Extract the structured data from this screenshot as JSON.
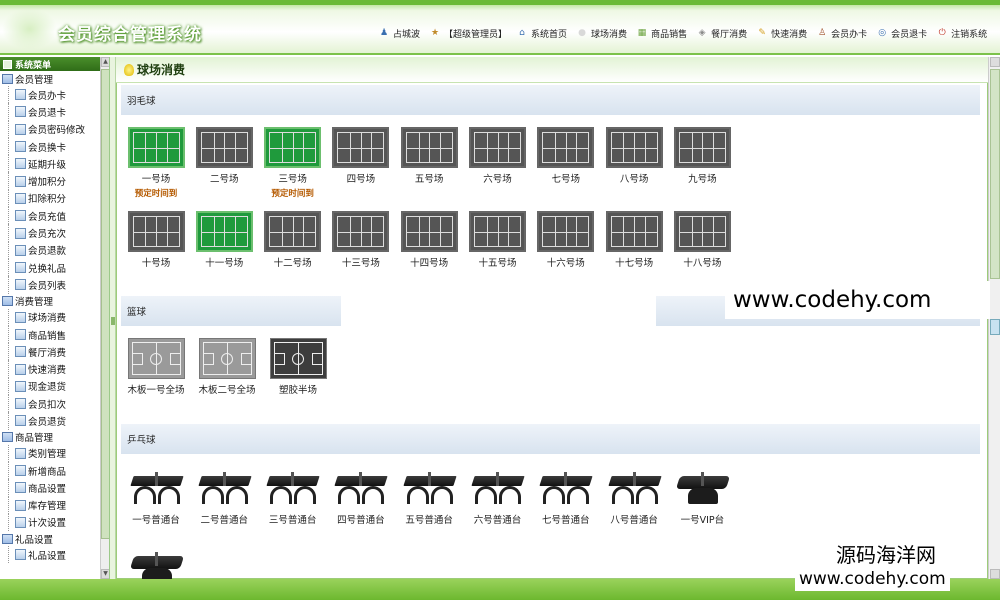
{
  "app": {
    "title": "会员综合管理系统"
  },
  "topnav": [
    {
      "label": "占城波",
      "icon": "user-icon",
      "color": "#3a6fb0"
    },
    {
      "label": "【超级管理员】",
      "icon": "admin-icon",
      "color": "#c08a2a"
    },
    {
      "label": "系统首页",
      "icon": "home-icon",
      "color": "#3a6fb0"
    },
    {
      "label": "球场消费",
      "icon": "ball-icon",
      "color": "#d9d9d9"
    },
    {
      "label": "商品销售",
      "icon": "goods-icon",
      "color": "#6aa23d"
    },
    {
      "label": "餐厅消费",
      "icon": "restaurant-icon",
      "color": "#8a8a8a"
    },
    {
      "label": "快速消费",
      "icon": "quick-icon",
      "color": "#d4a020"
    },
    {
      "label": "会员办卡",
      "icon": "member-card-icon",
      "color": "#a0522d"
    },
    {
      "label": "会员退卡",
      "icon": "return-card-icon",
      "color": "#3a6fb0"
    },
    {
      "label": "注销系统",
      "icon": "logout-icon",
      "color": "#c0392b"
    }
  ],
  "sidebar": {
    "header": "系统菜单",
    "groups": [
      {
        "label": "会员管理",
        "items": [
          "会员办卡",
          "会员退卡",
          "会员密码修改",
          "会员换卡",
          "延期升级",
          "增加积分",
          "扣除积分",
          "会员充值",
          "会员充次",
          "会员退款",
          "兑换礼品",
          "会员列表"
        ]
      },
      {
        "label": "消费管理",
        "items": [
          "球场消费",
          "商品销售",
          "餐厅消费",
          "快速消费",
          "现金退货",
          "会员扣次",
          "会员退货"
        ]
      },
      {
        "label": "商品管理",
        "items": [
          "类别管理",
          "新增商品",
          "商品设置",
          "库存管理",
          "计次设置"
        ]
      },
      {
        "label": "礼品设置",
        "items": [
          "礼品设置"
        ]
      }
    ]
  },
  "page": {
    "title": "球场消费"
  },
  "badminton": {
    "section": "羽毛球",
    "reserve_label": "预定时间到",
    "courts": [
      {
        "name": "一号场",
        "status": "busy",
        "reserved": true
      },
      {
        "name": "二号场",
        "status": "free",
        "reserved": false
      },
      {
        "name": "三号场",
        "status": "busy",
        "reserved": true
      },
      {
        "name": "四号场",
        "status": "free",
        "reserved": false
      },
      {
        "name": "五号场",
        "status": "free",
        "reserved": false
      },
      {
        "name": "六号场",
        "status": "free",
        "reserved": false
      },
      {
        "name": "七号场",
        "status": "free",
        "reserved": false
      },
      {
        "name": "八号场",
        "status": "free",
        "reserved": false
      },
      {
        "name": "九号场",
        "status": "free",
        "reserved": false
      },
      {
        "name": "十号场",
        "status": "free",
        "reserved": false
      },
      {
        "name": "十一号场",
        "status": "busy",
        "reserved": false
      },
      {
        "name": "十二号场",
        "status": "free",
        "reserved": false
      },
      {
        "name": "十三号场",
        "status": "free",
        "reserved": false
      },
      {
        "name": "十四号场",
        "status": "free",
        "reserved": false
      },
      {
        "name": "十五号场",
        "status": "free",
        "reserved": false
      },
      {
        "name": "十六号场",
        "status": "free",
        "reserved": false
      },
      {
        "name": "十七号场",
        "status": "free",
        "reserved": false
      },
      {
        "name": "十八号场",
        "status": "free",
        "reserved": false
      }
    ]
  },
  "basketball": {
    "section": "篮球",
    "courts": [
      {
        "name": "木板一号全场",
        "style": "light"
      },
      {
        "name": "木板二号全场",
        "style": "light"
      },
      {
        "name": "塑胶半场",
        "style": "dark"
      }
    ]
  },
  "pingpong": {
    "section": "乒乓球",
    "tables": [
      {
        "name": "一号普通台",
        "vip": false
      },
      {
        "name": "二号普通台",
        "vip": false
      },
      {
        "name": "三号普通台",
        "vip": false
      },
      {
        "name": "四号普通台",
        "vip": false
      },
      {
        "name": "五号普通台",
        "vip": false
      },
      {
        "name": "六号普通台",
        "vip": false
      },
      {
        "name": "七号普通台",
        "vip": false
      },
      {
        "name": "八号普通台",
        "vip": false
      },
      {
        "name": "一号VIP台",
        "vip": true
      },
      {
        "name": "",
        "vip": true
      }
    ]
  },
  "watermarks": {
    "url": "www.codehy.com",
    "brand": "源码海洋网",
    "url2": "www.codehy.com"
  }
}
